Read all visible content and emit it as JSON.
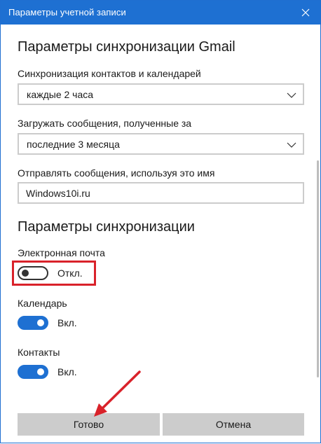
{
  "window": {
    "title": "Параметры учетной записи",
    "accent_color": "#1e70d2"
  },
  "gmail_sync": {
    "heading": "Параметры синхронизации Gmail",
    "contacts_calendar_label": "Синхронизация контактов и календарей",
    "contacts_calendar_value": "каждые 2 часа",
    "download_label": "Загружать сообщения, полученные за",
    "download_value": "последние 3 месяца",
    "sender_name_label": "Отправлять сообщения, используя это имя",
    "sender_name_value": "Windows10i.ru"
  },
  "sync_options": {
    "heading": "Параметры синхронизации",
    "items": [
      {
        "label": "Электронная почта",
        "state": "Откл.",
        "on": false
      },
      {
        "label": "Календарь",
        "state": "Вкл.",
        "on": true
      },
      {
        "label": "Контакты",
        "state": "Вкл.",
        "on": true
      }
    ]
  },
  "footer": {
    "done_label": "Готово",
    "cancel_label": "Отмена"
  },
  "annotation": {
    "highlight_color": "#d9222a"
  }
}
